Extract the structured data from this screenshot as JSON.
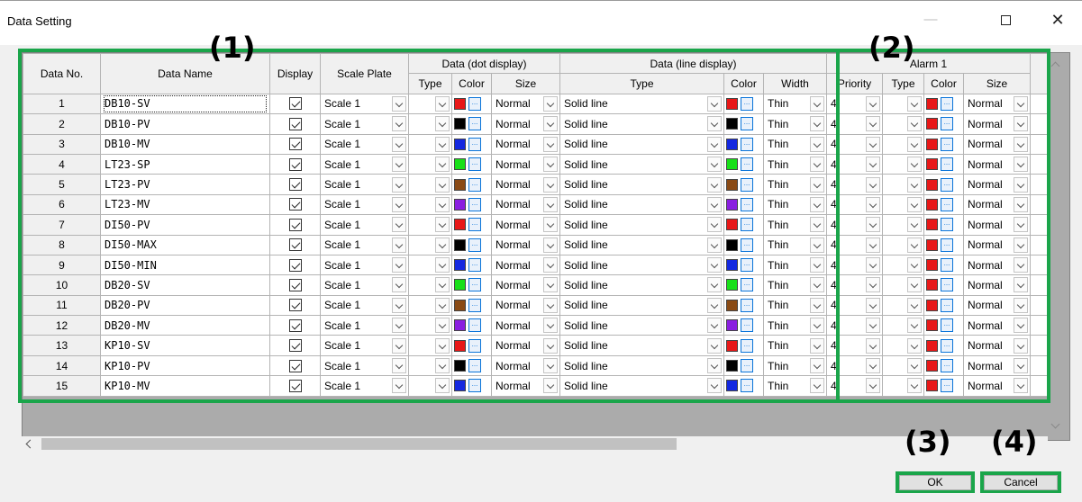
{
  "window": {
    "title": "Data Setting"
  },
  "headers": {
    "data_no": "Data No.",
    "data_name": "Data Name",
    "display": "Display",
    "scale_plate": "Scale Plate",
    "dot_group": "Data (dot display)",
    "line_group": "Data (line display)",
    "alarm_group": "Alarm 1",
    "type": "Type",
    "color": "Color",
    "size": "Size",
    "width": "Width",
    "priority": "Priority"
  },
  "rows": [
    {
      "no": "1",
      "name": "DB10-SV",
      "scale": "Scale 1",
      "dot_color": "#e81818",
      "dot_size": "Normal",
      "line_type": "Solid line",
      "line_color": "#e81818",
      "line_width": "Thin",
      "priority": "4",
      "alarm_color": "#e81818",
      "alarm_size": "Normal"
    },
    {
      "no": "2",
      "name": "DB10-PV",
      "scale": "Scale 1",
      "dot_color": "#000000",
      "dot_size": "Normal",
      "line_type": "Solid line",
      "line_color": "#000000",
      "line_width": "Thin",
      "priority": "4",
      "alarm_color": "#e81818",
      "alarm_size": "Normal"
    },
    {
      "no": "3",
      "name": "DB10-MV",
      "scale": "Scale 1",
      "dot_color": "#1428e0",
      "dot_size": "Normal",
      "line_type": "Solid line",
      "line_color": "#1428e0",
      "line_width": "Thin",
      "priority": "4",
      "alarm_color": "#e81818",
      "alarm_size": "Normal"
    },
    {
      "no": "4",
      "name": "LT23-SP",
      "scale": "Scale 1",
      "dot_color": "#18e018",
      "dot_size": "Normal",
      "line_type": "Solid line",
      "line_color": "#18e018",
      "line_width": "Thin",
      "priority": "4",
      "alarm_color": "#e81818",
      "alarm_size": "Normal"
    },
    {
      "no": "5",
      "name": "LT23-PV",
      "scale": "Scale 1",
      "dot_color": "#8a4a14",
      "dot_size": "Normal",
      "line_type": "Solid line",
      "line_color": "#8a4a14",
      "line_width": "Thin",
      "priority": "4",
      "alarm_color": "#e81818",
      "alarm_size": "Normal"
    },
    {
      "no": "6",
      "name": "LT23-MV",
      "scale": "Scale 1",
      "dot_color": "#8a1ee0",
      "dot_size": "Normal",
      "line_type": "Solid line",
      "line_color": "#8a1ee0",
      "line_width": "Thin",
      "priority": "4",
      "alarm_color": "#e81818",
      "alarm_size": "Normal"
    },
    {
      "no": "7",
      "name": "DI50-PV",
      "scale": "Scale 1",
      "dot_color": "#e81818",
      "dot_size": "Normal",
      "line_type": "Solid line",
      "line_color": "#e81818",
      "line_width": "Thin",
      "priority": "4",
      "alarm_color": "#e81818",
      "alarm_size": "Normal"
    },
    {
      "no": "8",
      "name": "DI50-MAX",
      "scale": "Scale 1",
      "dot_color": "#000000",
      "dot_size": "Normal",
      "line_type": "Solid line",
      "line_color": "#000000",
      "line_width": "Thin",
      "priority": "4",
      "alarm_color": "#e81818",
      "alarm_size": "Normal"
    },
    {
      "no": "9",
      "name": "DI50-MIN",
      "scale": "Scale 1",
      "dot_color": "#1428e0",
      "dot_size": "Normal",
      "line_type": "Solid line",
      "line_color": "#1428e0",
      "line_width": "Thin",
      "priority": "4",
      "alarm_color": "#e81818",
      "alarm_size": "Normal"
    },
    {
      "no": "10",
      "name": "DB20-SV",
      "scale": "Scale 1",
      "dot_color": "#18e018",
      "dot_size": "Normal",
      "line_type": "Solid line",
      "line_color": "#18e018",
      "line_width": "Thin",
      "priority": "4",
      "alarm_color": "#e81818",
      "alarm_size": "Normal"
    },
    {
      "no": "11",
      "name": "DB20-PV",
      "scale": "Scale 1",
      "dot_color": "#8a4a14",
      "dot_size": "Normal",
      "line_type": "Solid line",
      "line_color": "#8a4a14",
      "line_width": "Thin",
      "priority": "4",
      "alarm_color": "#e81818",
      "alarm_size": "Normal"
    },
    {
      "no": "12",
      "name": "DB20-MV",
      "scale": "Scale 1",
      "dot_color": "#8a1ee0",
      "dot_size": "Normal",
      "line_type": "Solid line",
      "line_color": "#8a1ee0",
      "line_width": "Thin",
      "priority": "4",
      "alarm_color": "#e81818",
      "alarm_size": "Normal"
    },
    {
      "no": "13",
      "name": "KP10-SV",
      "scale": "Scale 1",
      "dot_color": "#e81818",
      "dot_size": "Normal",
      "line_type": "Solid line",
      "line_color": "#e81818",
      "line_width": "Thin",
      "priority": "4",
      "alarm_color": "#e81818",
      "alarm_size": "Normal"
    },
    {
      "no": "14",
      "name": "KP10-PV",
      "scale": "Scale 1",
      "dot_color": "#000000",
      "dot_size": "Normal",
      "line_type": "Solid line",
      "line_color": "#000000",
      "line_width": "Thin",
      "priority": "4",
      "alarm_color": "#e81818",
      "alarm_size": "Normal"
    },
    {
      "no": "15",
      "name": "KP10-MV",
      "scale": "Scale 1",
      "dot_color": "#1428e0",
      "dot_size": "Normal",
      "line_type": "Solid line",
      "line_color": "#1428e0",
      "line_width": "Thin",
      "priority": "4",
      "alarm_color": "#e81818",
      "alarm_size": "Normal"
    }
  ],
  "callouts": {
    "c1": "(1)",
    "c2": "(2)",
    "c3": "(3)",
    "c4": "(4)"
  },
  "buttons": {
    "ok": "OK",
    "cancel": "Cancel"
  },
  "highlight_color": "#1aa54a"
}
